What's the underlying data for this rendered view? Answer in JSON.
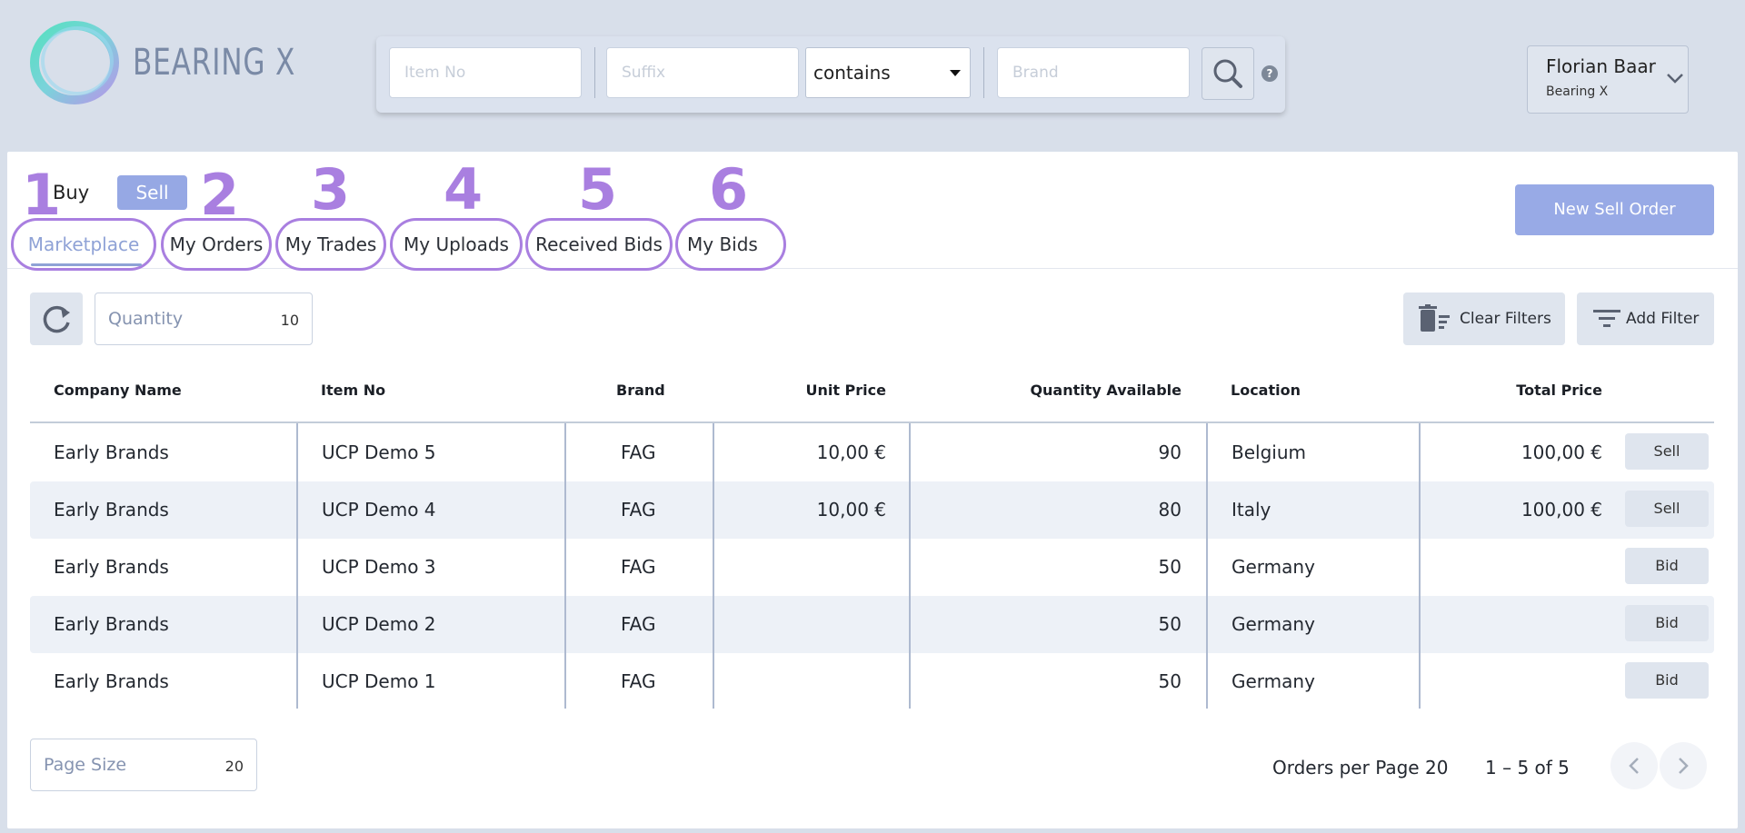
{
  "app": {
    "logo_text": "BEARING X"
  },
  "search": {
    "item_no_placeholder": "Item No",
    "suffix_placeholder": "Suffix",
    "match_mode": "contains",
    "brand_placeholder": "Brand",
    "help": "?"
  },
  "user": {
    "name": "Florian Baar",
    "company": "Bearing X"
  },
  "mode": {
    "buy_label": "Buy",
    "sell_label": "Sell",
    "active": "Sell"
  },
  "new_order_label": "New Sell Order",
  "tabs": [
    {
      "label": "Marketplace",
      "number": "1",
      "active": true
    },
    {
      "label": "My Orders",
      "number": "2"
    },
    {
      "label": "My Trades",
      "number": "3"
    },
    {
      "label": "My Uploads",
      "number": "4"
    },
    {
      "label": "Received Bids",
      "number": "5"
    },
    {
      "label": "My Bids",
      "number": "6"
    }
  ],
  "toolbar": {
    "quantity_label": "Quantity",
    "quantity_value": "10",
    "clear_filters_label": "Clear Filters",
    "add_filter_label": "Add Filter"
  },
  "table": {
    "headers": [
      "Company Name",
      "Item No",
      "Brand",
      "Unit Price",
      "Quantity Available",
      "Location",
      "Total Price"
    ],
    "rows": [
      {
        "company": "Early Brands",
        "item": "UCP Demo 5",
        "brand": "FAG",
        "unit_price": "10,00 €",
        "qty": "90",
        "location": "Belgium",
        "total": "100,00 €",
        "action": "Sell"
      },
      {
        "company": "Early Brands",
        "item": "UCP Demo 4",
        "brand": "FAG",
        "unit_price": "10,00 €",
        "qty": "80",
        "location": "Italy",
        "total": "100,00 €",
        "action": "Sell"
      },
      {
        "company": "Early Brands",
        "item": "UCP Demo 3",
        "brand": "FAG",
        "unit_price": "",
        "qty": "50",
        "location": "Germany",
        "total": "",
        "action": "Bid"
      },
      {
        "company": "Early Brands",
        "item": "UCP Demo 2",
        "brand": "FAG",
        "unit_price": "",
        "qty": "50",
        "location": "Germany",
        "total": "",
        "action": "Bid"
      },
      {
        "company": "Early Brands",
        "item": "UCP Demo 1",
        "brand": "FAG",
        "unit_price": "",
        "qty": "50",
        "location": "Germany",
        "total": "",
        "action": "Bid"
      }
    ]
  },
  "footer": {
    "page_size_label": "Page Size",
    "page_size_value": "20",
    "orders_per_page": "Orders per Page 20",
    "range": "1 – 5 of 5"
  },
  "colors": {
    "accent": "#96a8e4",
    "annotation": "#a97fe0",
    "background": "#d8dfea"
  },
  "icons": [
    "logo-ring-icon",
    "search-icon",
    "help-icon",
    "chevron-down-icon",
    "refresh-icon",
    "trash-filter-icon",
    "filter-icon",
    "chevron-left-icon",
    "chevron-right-icon"
  ]
}
